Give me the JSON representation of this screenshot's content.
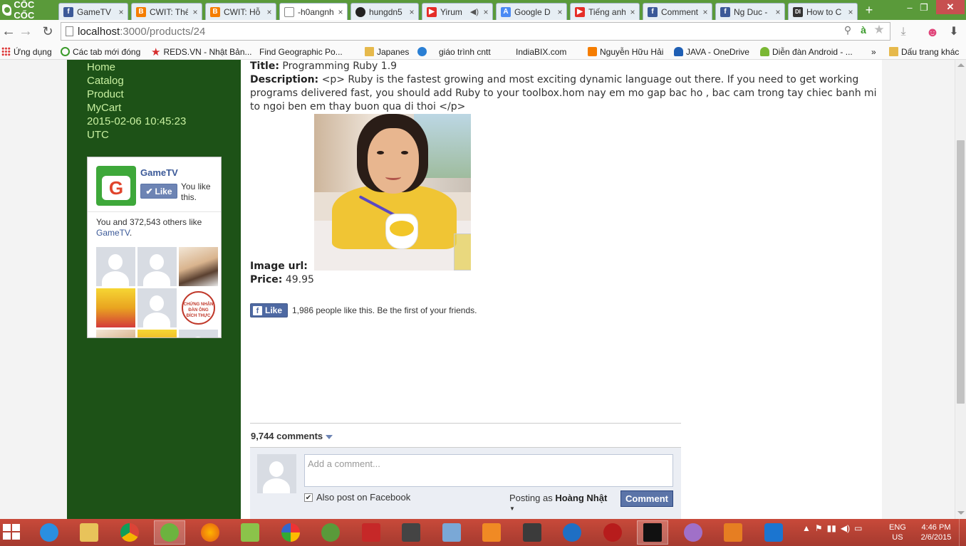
{
  "browser": {
    "brand": "CỐC CỐC",
    "tabs": [
      {
        "label": "GameTV",
        "icon": "facebook-icon",
        "color": "#3b5998",
        "glyph": "f",
        "active": false
      },
      {
        "label": "CWIT: Thế",
        "icon": "blogger-icon",
        "color": "#f57d00",
        "glyph": "B",
        "active": false
      },
      {
        "label": "CWIT: Hỗ",
        "icon": "blogger-icon",
        "color": "#f57d00",
        "glyph": "B",
        "active": false
      },
      {
        "label": "-h0angnh",
        "icon": "page-icon",
        "color": "#ffffff",
        "glyph": "",
        "active": true
      },
      {
        "label": "hungdn5",
        "icon": "github-icon",
        "color": "#222222",
        "glyph": "●",
        "active": false
      },
      {
        "label": "Yirum",
        "icon": "youtube-icon",
        "color": "#e52d27",
        "glyph": "▶",
        "active": false
      },
      {
        "label": "Google D",
        "icon": "google-translate-icon",
        "color": "#4a8af4",
        "glyph": "A",
        "active": false
      },
      {
        "label": "Tiếng anh",
        "icon": "youtube-icon",
        "color": "#e52d27",
        "glyph": "▶",
        "active": false
      },
      {
        "label": "Comment",
        "icon": "facebook-icon",
        "color": "#3b5998",
        "glyph": "f",
        "active": false
      },
      {
        "label": "Ng Duc -",
        "icon": "facebook-icon",
        "color": "#3b5998",
        "glyph": "f",
        "active": false
      },
      {
        "label": "How to C",
        "icon": "dzone-icon",
        "color": "#333333",
        "glyph": "DI",
        "active": false
      }
    ],
    "url_host": "localhost",
    "url_path": ":3000/products/24"
  },
  "bookmarks": [
    {
      "label": "Ứng dụng",
      "icon": "apps-icon"
    },
    {
      "label": "Các tab mới đóng",
      "icon": "history-icon"
    },
    {
      "label": "REDS.VN - Nhật Bản...",
      "icon": "star-icon"
    },
    {
      "label": "Find Geographic Po...",
      "icon": "page-icon"
    },
    {
      "label": "Japanes",
      "icon": "folder-icon"
    },
    {
      "label": "",
      "icon": "ie-icon"
    },
    {
      "label": "giáo trình cntt",
      "icon": "page-icon"
    },
    {
      "label": "IndiaBIX.com",
      "icon": "page-icon"
    },
    {
      "label": "Nguyễn Hữu Hải",
      "icon": "blogger-icon"
    },
    {
      "label": "JAVA - OneDrive",
      "icon": "onedrive-icon"
    },
    {
      "label": "Diễn đàn Android - ...",
      "icon": "android-icon"
    },
    {
      "label": "»",
      "icon": ""
    },
    {
      "label": "Dấu trang khác",
      "icon": "folder-icon"
    }
  ],
  "sidebar": {
    "nav": [
      "Home",
      "Catalog",
      "Product",
      "MyCart"
    ],
    "date": "2015-02-06 10:45:23",
    "tz": "UTC",
    "fb_widget": {
      "page_name": "GameTV",
      "like_label": "Like",
      "you_like": "You like this.",
      "others_prefix": "You and 372,543 others like",
      "others_page": "GameTV",
      "others_suffix": "."
    }
  },
  "product": {
    "title_label": "Title:",
    "title": "Programming Ruby 1.9",
    "desc_label": "Description:",
    "description": "<p> Ruby is the fastest growing and most exciting dynamic language out there. If you need to get working programs delivered fast, you should add Ruby to your toolbox.hom nay em mo gap bac ho , bac cam trong tay chiec banh mi to ngoi ben em thay buon qua di thoi </p>",
    "image_label": "Image url:",
    "price_label": "Price:",
    "price": "49.95"
  },
  "fb_like": {
    "like_label": "Like",
    "summary": "1,986 people like this. Be the first of your friends."
  },
  "comments": {
    "count": "9,744 comments",
    "placeholder": "Add a comment...",
    "also_post": "Also post on Facebook",
    "posting_as_prefix": "Posting as",
    "posting_as_name": "Hoàng Nhật",
    "submit": "Comment"
  },
  "taskbar": {
    "lang_top": "ENG",
    "lang_bottom": "US",
    "time": "4:46 PM",
    "date": "2/6/2015"
  }
}
